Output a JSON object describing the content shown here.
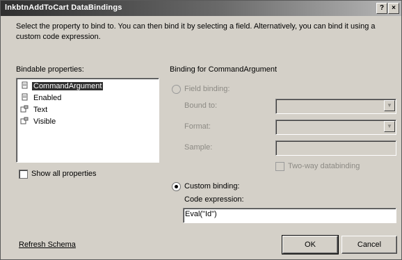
{
  "window": {
    "title": "lnkbtnAddToCart DataBindings",
    "help_label": "?",
    "close_label": "×"
  },
  "intro": "Select the property to bind to. You can then bind it by selecting a field. Alternatively, you can bind it using a custom code expression.",
  "bindable": {
    "label": "Bindable properties:",
    "items": [
      {
        "label": "CommandArgument",
        "icon": "property-icon",
        "selected": true
      },
      {
        "label": "Enabled",
        "icon": "property-icon",
        "selected": false
      },
      {
        "label": "Text",
        "icon": "bound-property-icon",
        "selected": false
      },
      {
        "label": "Visible",
        "icon": "bound-property-icon",
        "selected": false
      }
    ],
    "show_all_label": "Show all properties",
    "show_all_checked": false
  },
  "binding": {
    "heading": "Binding for CommandArgument",
    "field_binding_label": "Field binding:",
    "bound_to_label": "Bound to:",
    "format_label": "Format:",
    "sample_label": "Sample:",
    "two_way_label": "Two-way databinding",
    "custom_binding_label": "Custom binding:",
    "custom_binding_selected": true,
    "code_expression_label": "Code expression:",
    "code_expression_value": "Eval(\"Id\")"
  },
  "footer": {
    "refresh_schema": "Refresh Schema",
    "ok": "OK",
    "cancel": "Cancel"
  },
  "colors": {
    "dialog_bg": "#d4d0c8",
    "selection": "#2f2f2f"
  }
}
